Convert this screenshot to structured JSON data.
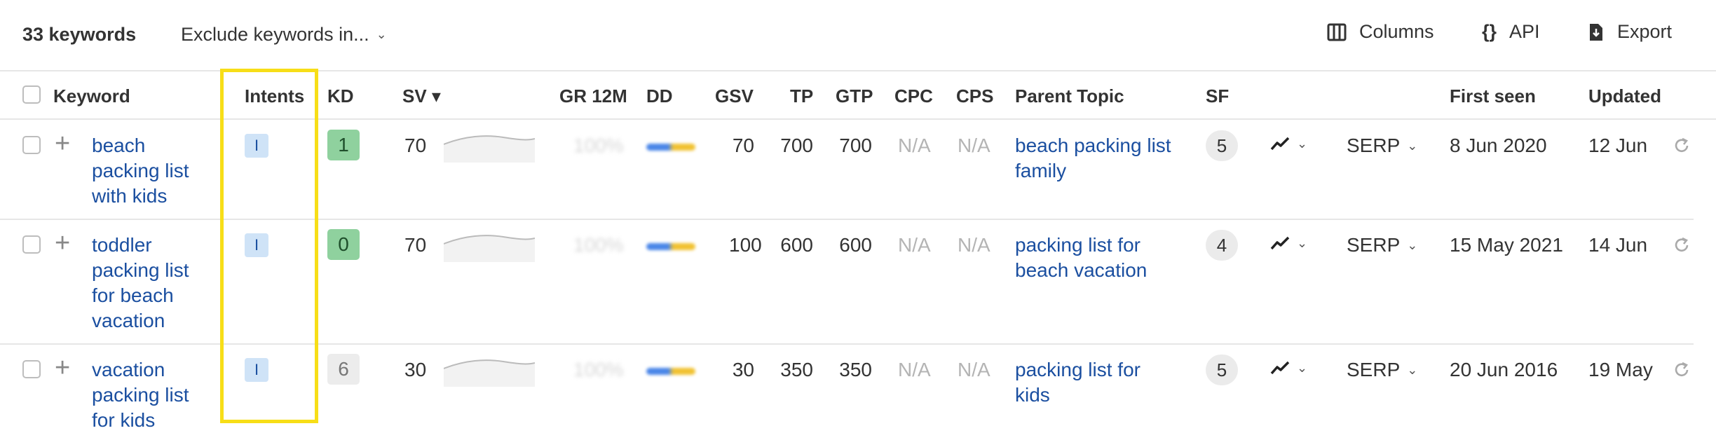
{
  "toolbar": {
    "count": "33 keywords",
    "exclude_label": "Exclude keywords in...",
    "columns_label": "Columns",
    "api_label": "API",
    "api_icon": "{}",
    "export_label": "Export"
  },
  "columns": {
    "keyword": "Keyword",
    "intents": "Intents",
    "kd": "KD",
    "sv": "SV",
    "sv_sort": "▾",
    "gr": "GR 12M",
    "dd": "DD",
    "gsv": "GSV",
    "tp": "TP",
    "gtp": "GTP",
    "cpc": "CPC",
    "cps": "CPS",
    "parent": "Parent Topic",
    "sf": "SF",
    "first_seen": "First seen",
    "updated": "Updated"
  },
  "colors": {
    "highlight": "#f7de18",
    "kd_easy": "#8fd19e",
    "kd_gray": "#ececec",
    "link": "#1b4fa0"
  },
  "rows": [
    {
      "kw_lines": [
        "beach",
        "packing list",
        "with kids"
      ],
      "intent": "I",
      "kd": "1",
      "sv": "70",
      "gr": "100%",
      "gsv": "70",
      "tp": "700",
      "gtp": "700",
      "cpc": "N/A",
      "cps": "N/A",
      "parent_lines": [
        "beach packing list",
        "family"
      ],
      "sf": "5",
      "serp": "SERP",
      "first_seen": "8 Jun 2020",
      "updated": "12 Jun"
    },
    {
      "kw_lines": [
        "toddler",
        "packing list",
        "for beach",
        "vacation"
      ],
      "intent": "I",
      "kd": "0",
      "sv": "70",
      "gr": "100%",
      "gsv": "100",
      "tp": "600",
      "gtp": "600",
      "cpc": "N/A",
      "cps": "N/A",
      "parent_lines": [
        "packing list for",
        "beach vacation"
      ],
      "sf": "4",
      "serp": "SERP",
      "first_seen": "15 May 2021",
      "updated": "14 Jun"
    },
    {
      "kw_lines": [
        "vacation",
        "packing list",
        "for kids"
      ],
      "intent": "I",
      "kd": "6",
      "sv": "30",
      "gr": "100%",
      "gsv": "30",
      "tp": "350",
      "gtp": "350",
      "cpc": "N/A",
      "cps": "N/A",
      "parent_lines": [
        "packing list for",
        "kids"
      ],
      "sf": "5",
      "serp": "SERP",
      "first_seen": "20 Jun 2016",
      "updated": "19 May"
    }
  ]
}
